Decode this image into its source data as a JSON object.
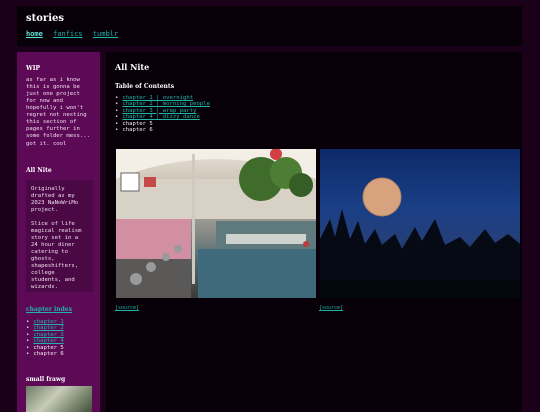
{
  "site": {
    "title": "stories"
  },
  "nav": {
    "home": "home",
    "fanfics": "fanfics",
    "tumblr": "tumblr"
  },
  "sidebar": {
    "wip_title": "WIP",
    "wip_text": "as far as i know\nthis is gonna be\njust one project\nfor now and\nhopefully i won't\nregret not nesting\nthis section of\npages further in\nsome folder mess...",
    "wip_text2": "got it. cool",
    "allnite_title": "All Nite",
    "allnite_box": "Originally\ndrafted as my\n2023 NaNoWriMo\nproject.\n\nSlice of life\nmagical realism\nstory set in a\n24 hour diner\ncatering to\nghosts,\nshapeshifters,\ncollege\nstudents, and\nwizards.",
    "chapter_index_title": "chapter index",
    "chapters": [
      {
        "label": "chapter 1"
      },
      {
        "label": "chapter 2"
      },
      {
        "label": "chapter 3"
      },
      {
        "label": "chapter 4"
      },
      {
        "label": "chapter 5"
      },
      {
        "label": "chapter 6"
      }
    ],
    "small_frawg_title": "small frawg"
  },
  "main": {
    "title": "All Nite",
    "toc_title": "Table of Contents",
    "toc": [
      {
        "label": "chapter 1 | overnight"
      },
      {
        "label": "chapter 2 | morning people"
      },
      {
        "label": "chapter 3 | wrap party"
      },
      {
        "label": "chapter 4 | dizzy dance"
      },
      {
        "label": "chapter 5"
      },
      {
        "label": "chapter 6"
      }
    ],
    "source_1": "[source]",
    "source_2": "[source]"
  },
  "colors": {
    "background": "#1a0019",
    "sidebar": "#5c0a55",
    "panel": "#080008",
    "link": "#21b3a8"
  }
}
